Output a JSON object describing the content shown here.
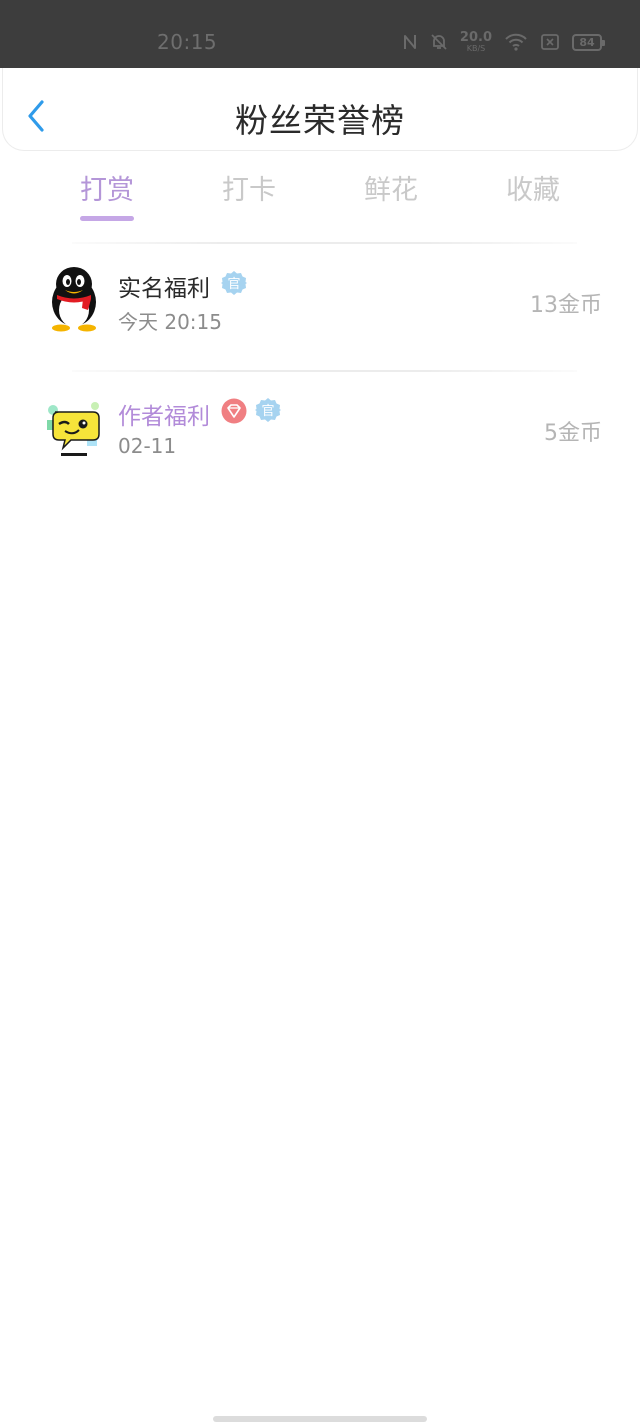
{
  "status_bar": {
    "time": "20:15",
    "net_speed": "20.0",
    "net_speed_unit": "KB/S",
    "battery": "84",
    "icons": [
      "nfc-icon",
      "bell-muted-icon",
      "wifi-icon",
      "sim-disabled-icon",
      "battery-icon"
    ]
  },
  "header": {
    "title": "粉丝荣誉榜",
    "back_icon": "chevron-left-icon"
  },
  "tabs": [
    {
      "label": "打赏",
      "active": true
    },
    {
      "label": "打卡",
      "active": false
    },
    {
      "label": "鲜花",
      "active": false
    },
    {
      "label": "收藏",
      "active": false
    }
  ],
  "list": [
    {
      "name": "实名福利",
      "date": "今天 20:15",
      "amount": "13金币",
      "avatar": "penguin-avatar",
      "badges": [
        "official-badge"
      ],
      "badge_text": "官"
    },
    {
      "name": "作者福利",
      "date": "02-11",
      "amount": "5金币",
      "avatar": "chat-bubble-avatar",
      "badges": [
        "diamond-badge",
        "official-badge"
      ],
      "badge_text": "官"
    }
  ],
  "colors": {
    "accent": "#b496d8",
    "back_arrow": "#2f9bea",
    "name_highlight": "#b28bd9",
    "official_badge": "#a6d3f0",
    "diamond_badge": "#f07f82"
  }
}
